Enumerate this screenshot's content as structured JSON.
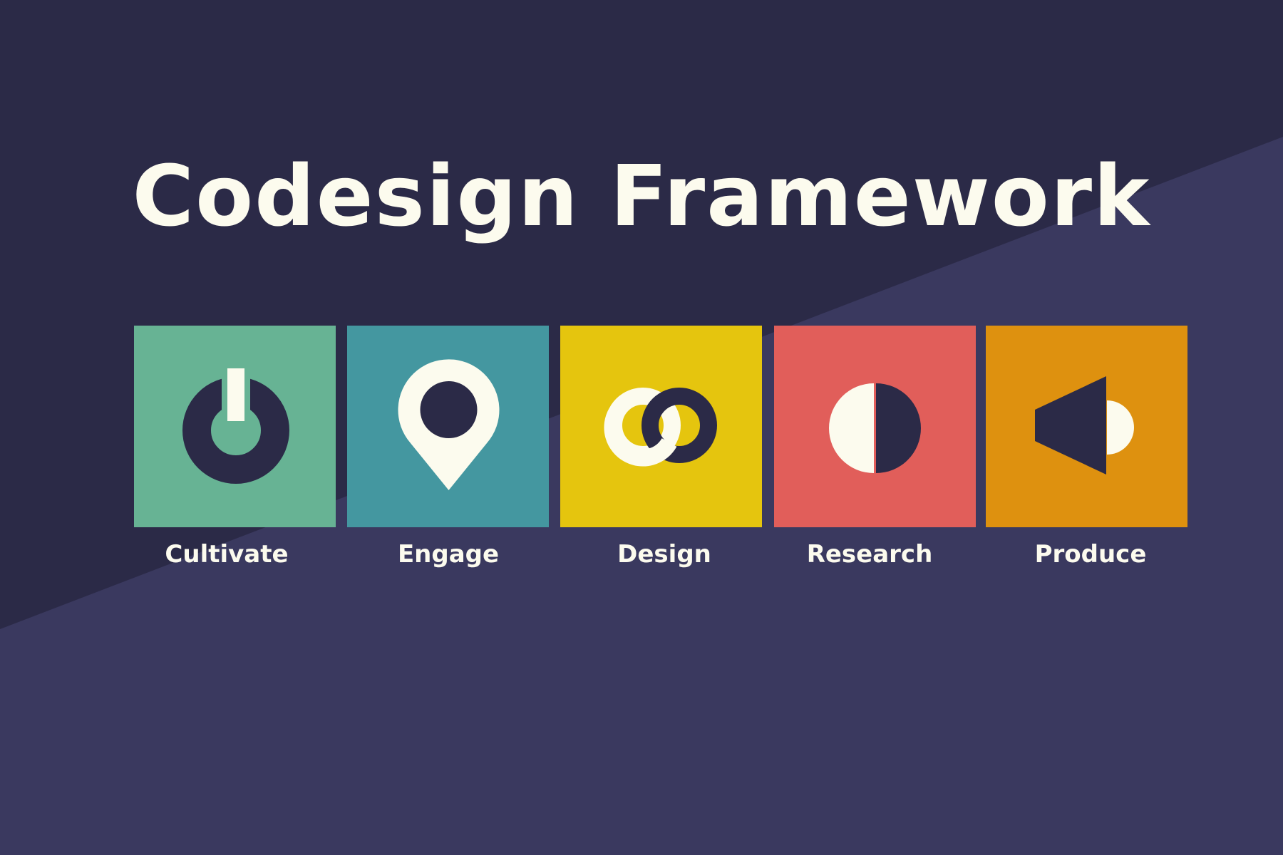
{
  "title": "Codesign Framework",
  "colors": {
    "background_dark": "#2B2A47",
    "background_light": "#3A395F",
    "cream": "#FCFBEE",
    "navy": "#2B2A47"
  },
  "stages": [
    {
      "label": "Cultivate",
      "icon": "power-icon",
      "color": "#67B394"
    },
    {
      "label": "Engage",
      "icon": "location-pin-icon",
      "color": "#4497A0"
    },
    {
      "label": "Design",
      "icon": "linked-rings-icon",
      "color": "#E5C50E"
    },
    {
      "label": "Research",
      "icon": "half-circle-icon",
      "color": "#E15E5A"
    },
    {
      "label": "Produce",
      "icon": "megaphone-icon",
      "color": "#DE910F"
    }
  ]
}
